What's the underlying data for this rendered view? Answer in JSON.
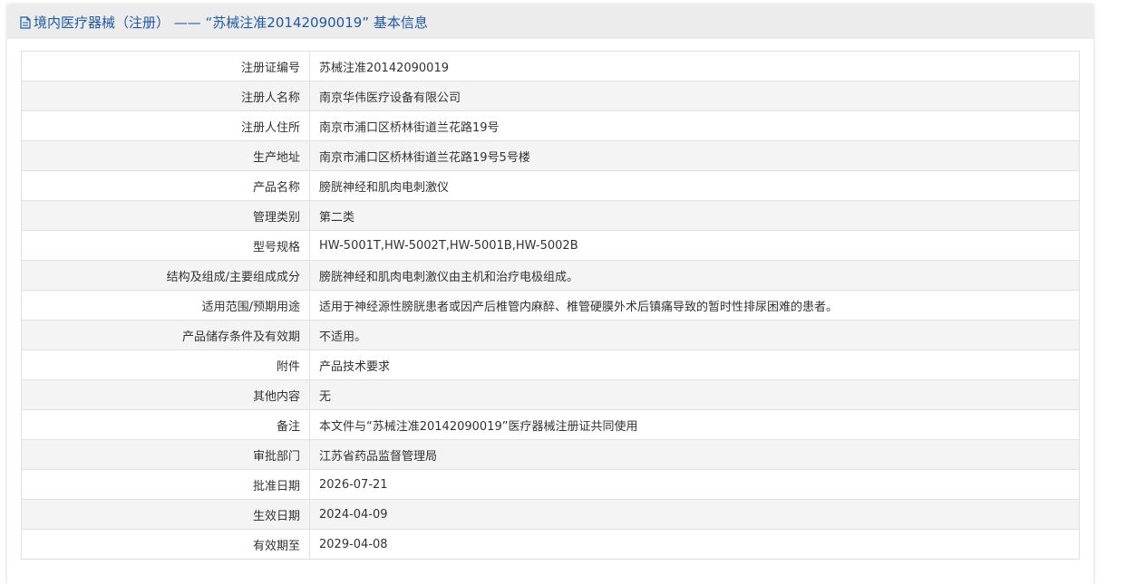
{
  "header": {
    "icon": "document-icon",
    "title": "境内医疗器械（注册） —— “苏械注准20142090019” 基本信息"
  },
  "colors": {
    "title": "#1e5aa8",
    "header_bg": "#ececec",
    "row_alt_bg": "#f4f4f4",
    "border": "#e1e1e1",
    "text": "#333333"
  },
  "rows": [
    {
      "label": "注册证编号",
      "value": "苏械注准20142090019"
    },
    {
      "label": "注册人名称",
      "value": "南京华伟医疗设备有限公司"
    },
    {
      "label": "注册人住所",
      "value": "南京市浦口区桥林街道兰花路19号"
    },
    {
      "label": "生产地址",
      "value": "南京市浦口区桥林街道兰花路19号5号楼"
    },
    {
      "label": "产品名称",
      "value": "膀胱神经和肌肉电刺激仪"
    },
    {
      "label": "管理类别",
      "value": "第二类"
    },
    {
      "label": "型号规格",
      "value": "HW-5001T,HW-5002T,HW-5001B,HW-5002B"
    },
    {
      "label": "结构及组成/主要组成成分",
      "value": "膀胱神经和肌肉电刺激仪由主机和治疗电极组成。"
    },
    {
      "label": "适用范围/预期用途",
      "value": "适用于神经源性膀胱患者或因产后椎管内麻醉、椎管硬膜外术后镇痛导致的暂时性排尿困难的患者。"
    },
    {
      "label": "产品储存条件及有效期",
      "value": "不适用。"
    },
    {
      "label": "附件",
      "value": "产品技术要求"
    },
    {
      "label": "其他内容",
      "value": "无"
    },
    {
      "label": "备注",
      "value": "本文件与“苏械注准20142090019”医疗器械注册证共同使用"
    },
    {
      "label": "审批部门",
      "value": "江苏省药品监督管理局"
    },
    {
      "label": "批准日期",
      "value": "2026-07-21"
    },
    {
      "label": "生效日期",
      "value": "2024-04-09"
    },
    {
      "label": "有效期至",
      "value": "2029-04-08"
    }
  ]
}
